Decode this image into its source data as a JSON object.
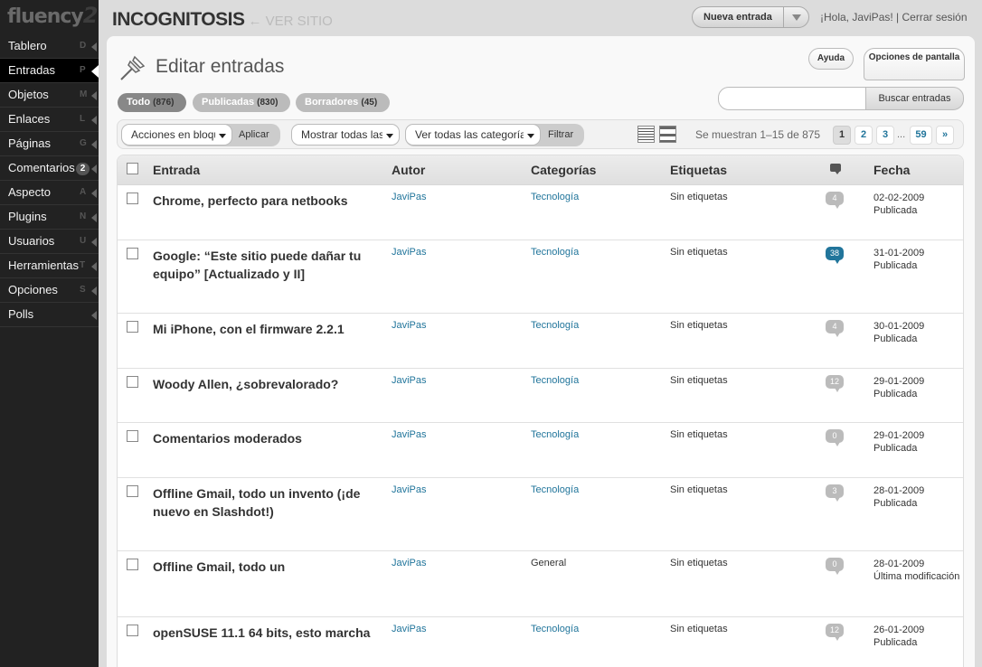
{
  "logo": {
    "text": "fluency",
    "sup": "2"
  },
  "sidebar": {
    "items": [
      {
        "label": "Tablero",
        "key": "D"
      },
      {
        "label": "Entradas",
        "key": "P",
        "active": true
      },
      {
        "label": "Objetos",
        "key": "M"
      },
      {
        "label": "Enlaces",
        "key": "L"
      },
      {
        "label": "Páginas",
        "key": "G"
      },
      {
        "label": "Comentarios",
        "count": "2"
      },
      {
        "label": "Aspecto",
        "key": "A"
      },
      {
        "label": "Plugins",
        "key": "N"
      },
      {
        "label": "Usuarios",
        "key": "U"
      },
      {
        "label": "Herramientas",
        "key": "T"
      },
      {
        "label": "Opciones",
        "key": "S"
      },
      {
        "label": "Polls",
        "key": ""
      }
    ]
  },
  "header": {
    "site_title": "INCOGNITOSIS",
    "view_site": "← VER SITIO",
    "new_entry": "Nueva entrada",
    "greeting": "¡Hola, JaviPas! | Cerrar sesión"
  },
  "page": {
    "title": "Editar entradas",
    "help": "Ayuda",
    "screen_options": "Opciones de pantalla"
  },
  "filters": [
    {
      "label": "Todo",
      "count": "(876)"
    },
    {
      "label": "Publicadas",
      "count": "(830)"
    },
    {
      "label": "Borradores",
      "count": "(45)"
    }
  ],
  "search": {
    "value": "",
    "placeholder": "",
    "button": "Buscar entradas"
  },
  "toolbar": {
    "bulk_actions": "Acciones en bloque",
    "apply": "Aplicar",
    "dates": "Mostrar todas las fechas",
    "categories": "Ver todas las categorías",
    "filter": "Filtrar",
    "showing": "Se muestran 1–15 de 875",
    "pages": [
      "1",
      "2",
      "3",
      "59",
      "»"
    ],
    "dots": "..."
  },
  "table": {
    "headers": {
      "entry": "Entrada",
      "author": "Autor",
      "categories": "Categorías",
      "tags": "Etiquetas",
      "date": "Fecha"
    },
    "rows": [
      {
        "title": "Chrome, perfecto para netbooks",
        "author": "JaviPas",
        "category": "Tecnología",
        "tags": "Sin etiquetas",
        "comments": "4",
        "date": "02-02-2009",
        "status": "Publicada"
      },
      {
        "title": "Google: “Este sitio puede dañar tu equipo” [Actualizado y II]",
        "author": "JaviPas",
        "category": "Tecnología",
        "tags": "Sin etiquetas",
        "comments": "38",
        "date": "31-01-2009",
        "status": "Publicada"
      },
      {
        "title": "Mi iPhone, con el firmware 2.2.1",
        "author": "JaviPas",
        "category": "Tecnología",
        "tags": "Sin etiquetas",
        "comments": "4",
        "date": "30-01-2009",
        "status": "Publicada"
      },
      {
        "title": "Woody Allen, ¿sobrevalorado?",
        "author": "JaviPas",
        "category": "Tecnología",
        "tags": "Sin etiquetas",
        "comments": "12",
        "date": "29-01-2009",
        "status": "Publicada"
      },
      {
        "title": "Comentarios moderados",
        "author": "JaviPas",
        "category": "Tecnología",
        "tags": "Sin etiquetas",
        "comments": "0",
        "date": "29-01-2009",
        "status": "Publicada"
      },
      {
        "title": "Offline Gmail, todo un invento (¡de nuevo en Slashdot!)",
        "author": "JaviPas",
        "category": "Tecnología",
        "tags": "Sin etiquetas",
        "comments": "3",
        "date": "28-01-2009",
        "status": "Publicada"
      },
      {
        "title": "Offline Gmail, todo un",
        "author": "JaviPas",
        "category": "General",
        "tags": "Sin etiquetas",
        "comments": "0",
        "date": "28-01-2009",
        "status": "Última modificación"
      },
      {
        "title": "openSUSE 11.1 64 bits, esto marcha",
        "author": "JaviPas",
        "category": "Tecnología",
        "tags": "Sin etiquetas",
        "comments": "12",
        "date": "26-01-2009",
        "status": "Publicada"
      }
    ]
  }
}
